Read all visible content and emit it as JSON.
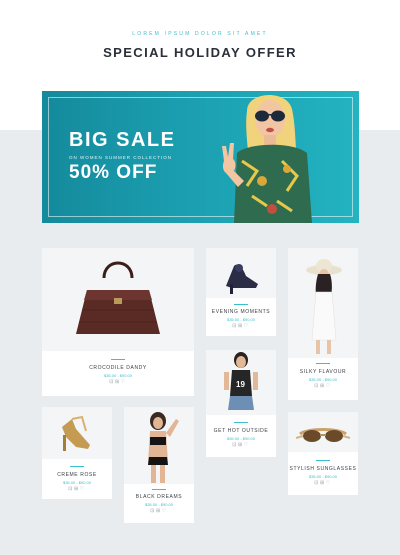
{
  "header": {
    "eyebrow": "LOREM IPSUM DOLOR SIT AMET",
    "title": "SPECIAL HOLIDAY OFFER"
  },
  "banner": {
    "headline": "BIG SALE",
    "subline": "ON WOMEN SUMMER COLLECTION",
    "discount": "50%  OFF"
  },
  "products": [
    {
      "name": "CROCODILE DANDY",
      "price": "$35.00 - $90.00"
    },
    {
      "name": "EVENING MOMENTS",
      "price": "$35.00 - $90.00"
    },
    {
      "name": "SILKY FLAVOUR",
      "price": "$35.00 - $90.00"
    },
    {
      "name": "GET HOT OUTSIDE",
      "price": "$35.00 - $90.00"
    },
    {
      "name": "CREME ROSE",
      "price": "$35.00 - $90.00"
    },
    {
      "name": "BLACK DREAMS",
      "price": "$35.00 - $90.00"
    },
    {
      "name": "STYLISH SUNGLASSES",
      "price": "$35.00 - $90.00"
    }
  ],
  "actions": {
    "cart_icon": "⊡",
    "compare_icon": "⊞",
    "wishlist_icon": "♡"
  },
  "colors": {
    "accent": "#3bbfcf",
    "banner": "#1b9fb0",
    "background": "#e8ecef"
  }
}
